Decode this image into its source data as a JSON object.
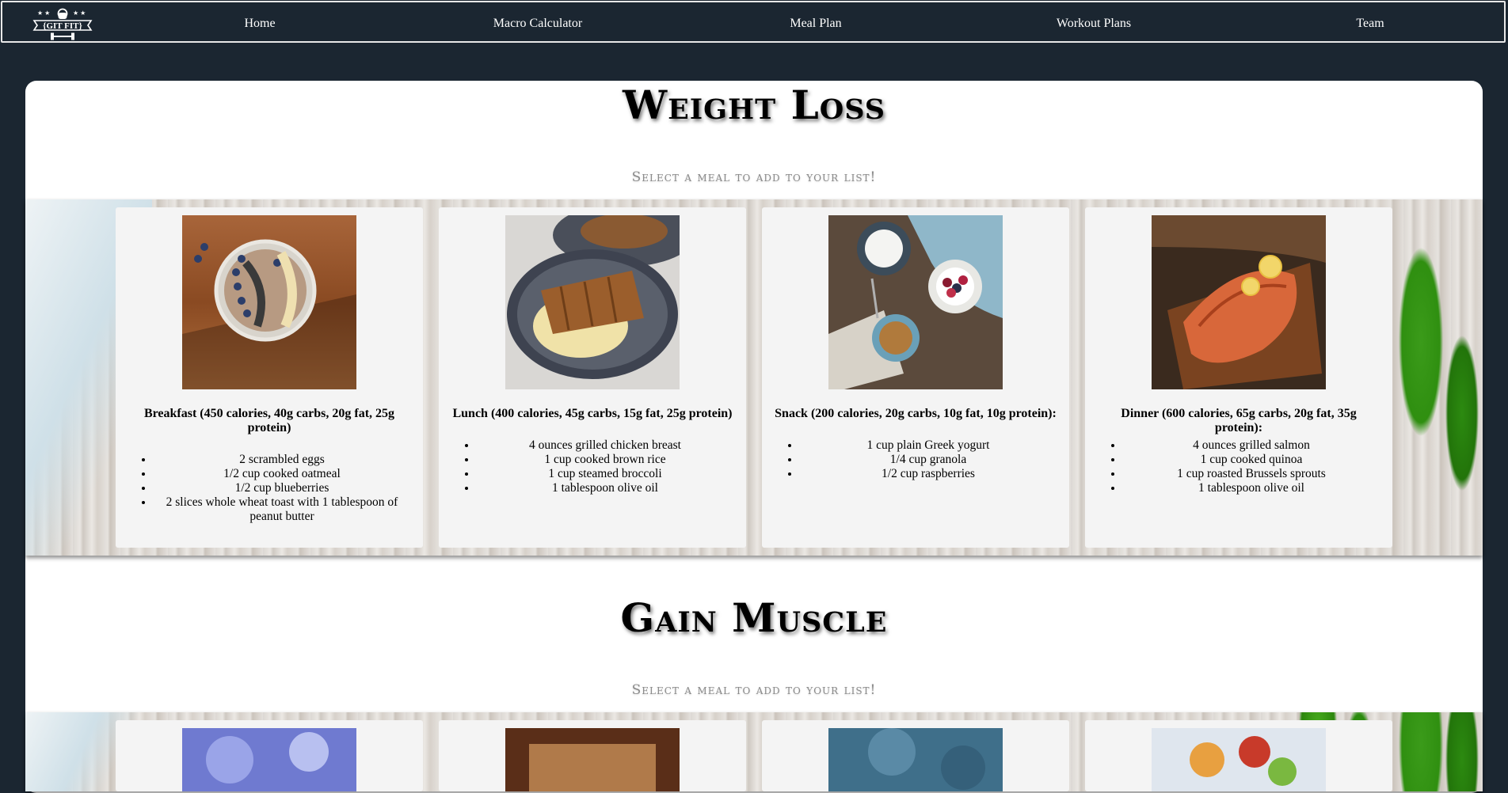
{
  "nav": {
    "logo_text": "GIT FIT",
    "items": [
      "Home",
      "Macro Calculator",
      "Meal Plan",
      "Workout Plans",
      "Team"
    ]
  },
  "sections": [
    {
      "title": "Weight Loss",
      "subtitle": "Select a meal to add to your list!",
      "meals": [
        {
          "heading": "Breakfast (450 calories, 40g carbs, 20g fat, 25g protein)",
          "items": [
            "2 scrambled eggs",
            "1/2 cup cooked oatmeal",
            "1/2 cup blueberries",
            "2 slices whole wheat toast with 1 tablespoon of peanut butter"
          ]
        },
        {
          "heading": "Lunch (400 calories, 45g carbs, 15g fat, 25g protein)",
          "items": [
            "4 ounces grilled chicken breast",
            "1 cup cooked brown rice",
            "1 cup steamed broccoli",
            "1 tablespoon olive oil"
          ]
        },
        {
          "heading": "Snack (200 calories, 20g carbs, 10g fat, 10g protein):",
          "items": [
            "1 cup plain Greek yogurt",
            "1/4 cup granola",
            "1/2 cup raspberries"
          ]
        },
        {
          "heading": "Dinner (600 calories, 65g carbs, 20g fat, 35g protein):",
          "items": [
            "4 ounces grilled salmon",
            "1 cup cooked quinoa",
            "1 cup roasted Brussels sprouts",
            "1 tablespoon olive oil"
          ]
        }
      ]
    },
    {
      "title": "Gain Muscle",
      "subtitle": "Select a meal to add to your list!"
    }
  ]
}
